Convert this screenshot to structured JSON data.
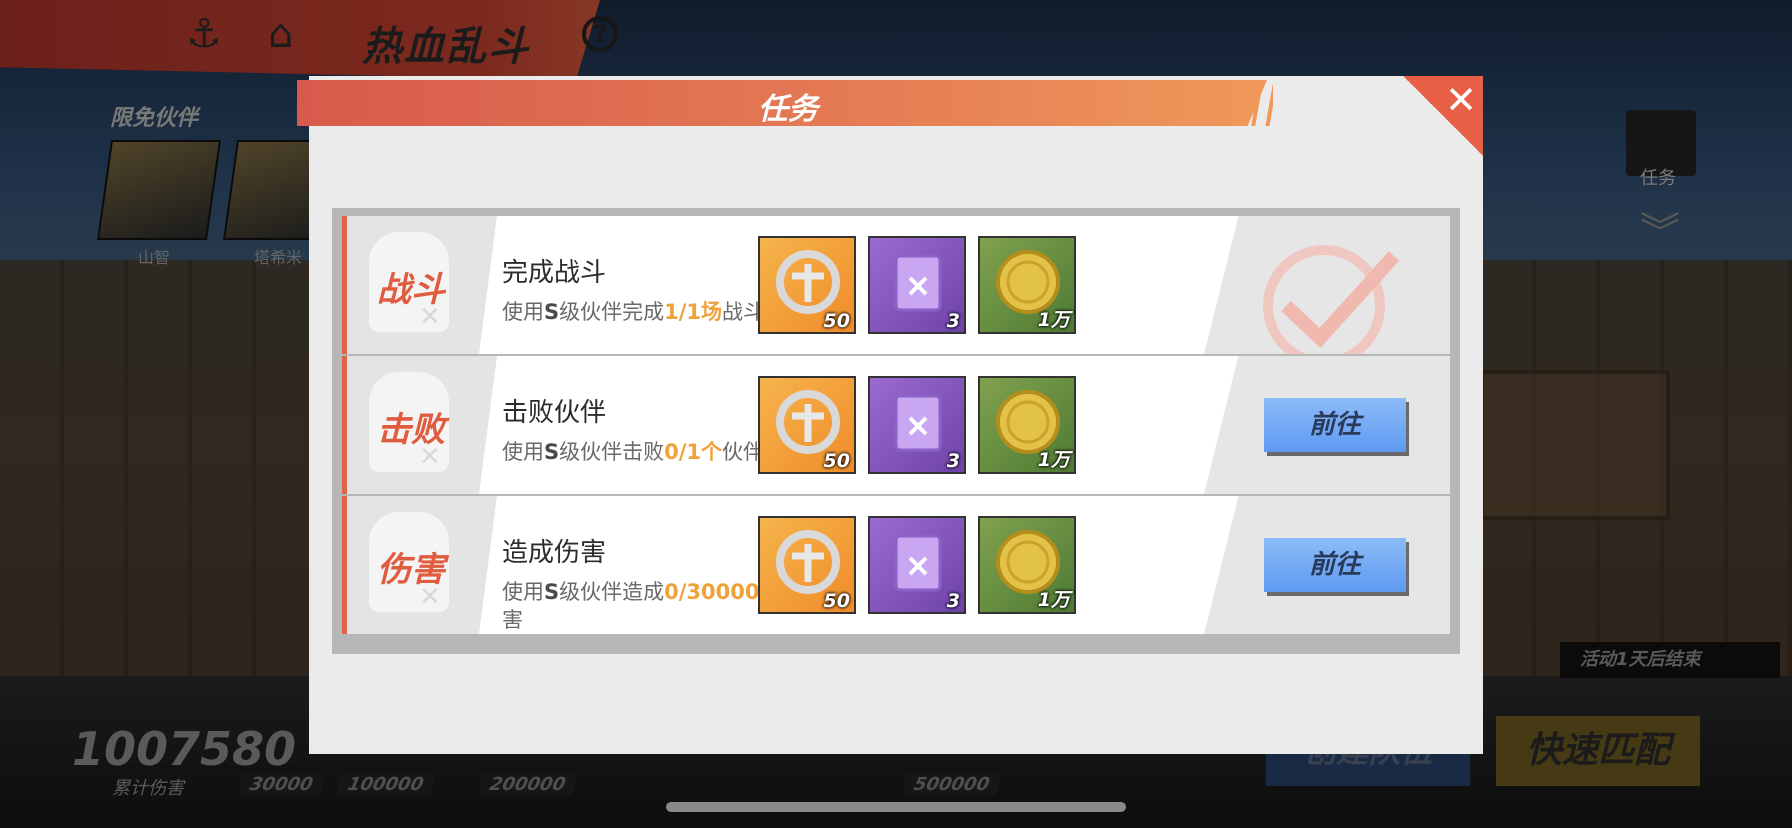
{
  "topbar": {
    "back_icon": "back-anchor-icon",
    "home_icon": "home-icon",
    "title": "热血乱斗",
    "help_icon": "help-icon"
  },
  "partners": {
    "label": "限免伙伴",
    "items": [
      {
        "name": "山智"
      },
      {
        "name": "塔希米"
      }
    ]
  },
  "side_task": {
    "label": "任务"
  },
  "modal": {
    "title": "任务",
    "close_icon": "close-icon"
  },
  "tasks": [
    {
      "tag": "战斗",
      "name": "完成战斗",
      "desc_prefix": "使用",
      "desc_grade": "S",
      "desc_mid": "级伙伴完成",
      "progress": "1/1",
      "unit": "场",
      "desc_suffix": "战斗",
      "rewards": [
        {
          "icon": "badge-icon",
          "count": "50"
        },
        {
          "icon": "exp-book-icon",
          "count": "3"
        },
        {
          "icon": "gold-coin-icon",
          "count": "1万"
        }
      ],
      "status": "completed"
    },
    {
      "tag": "击败",
      "name": "击败伙伴",
      "desc_prefix": "使用",
      "desc_grade": "S",
      "desc_mid": "级伙伴击败",
      "progress": "0/1",
      "unit": "个",
      "desc_suffix": "伙伴",
      "rewards": [
        {
          "icon": "badge-icon",
          "count": "50"
        },
        {
          "icon": "exp-book-icon",
          "count": "3"
        },
        {
          "icon": "gold-coin-icon",
          "count": "1万"
        }
      ],
      "status": "go",
      "button_label": "前往"
    },
    {
      "tag": "伤害",
      "name": "造成伤害",
      "desc_prefix": "使用",
      "desc_grade": "S",
      "desc_mid": "级伙伴造成",
      "progress": "0/30000",
      "unit": "点",
      "desc_suffix": "伤害",
      "rewards": [
        {
          "icon": "badge-icon",
          "count": "50"
        },
        {
          "icon": "exp-book-icon",
          "count": "3"
        },
        {
          "icon": "gold-coin-icon",
          "count": "1万"
        }
      ],
      "status": "go",
      "button_label": "前往"
    }
  ],
  "bottom": {
    "damage_total": "1007580",
    "damage_label": "累计伤害",
    "milestones": [
      "30000",
      "100000",
      "200000",
      "500000"
    ],
    "activity_end": "活动1天后结束",
    "create_team": "创建队伍",
    "quick_match": "快速匹配"
  },
  "colors": {
    "accent": "#e0634a",
    "progress": "#f0a23a",
    "go_button": "#6ea6f4"
  }
}
